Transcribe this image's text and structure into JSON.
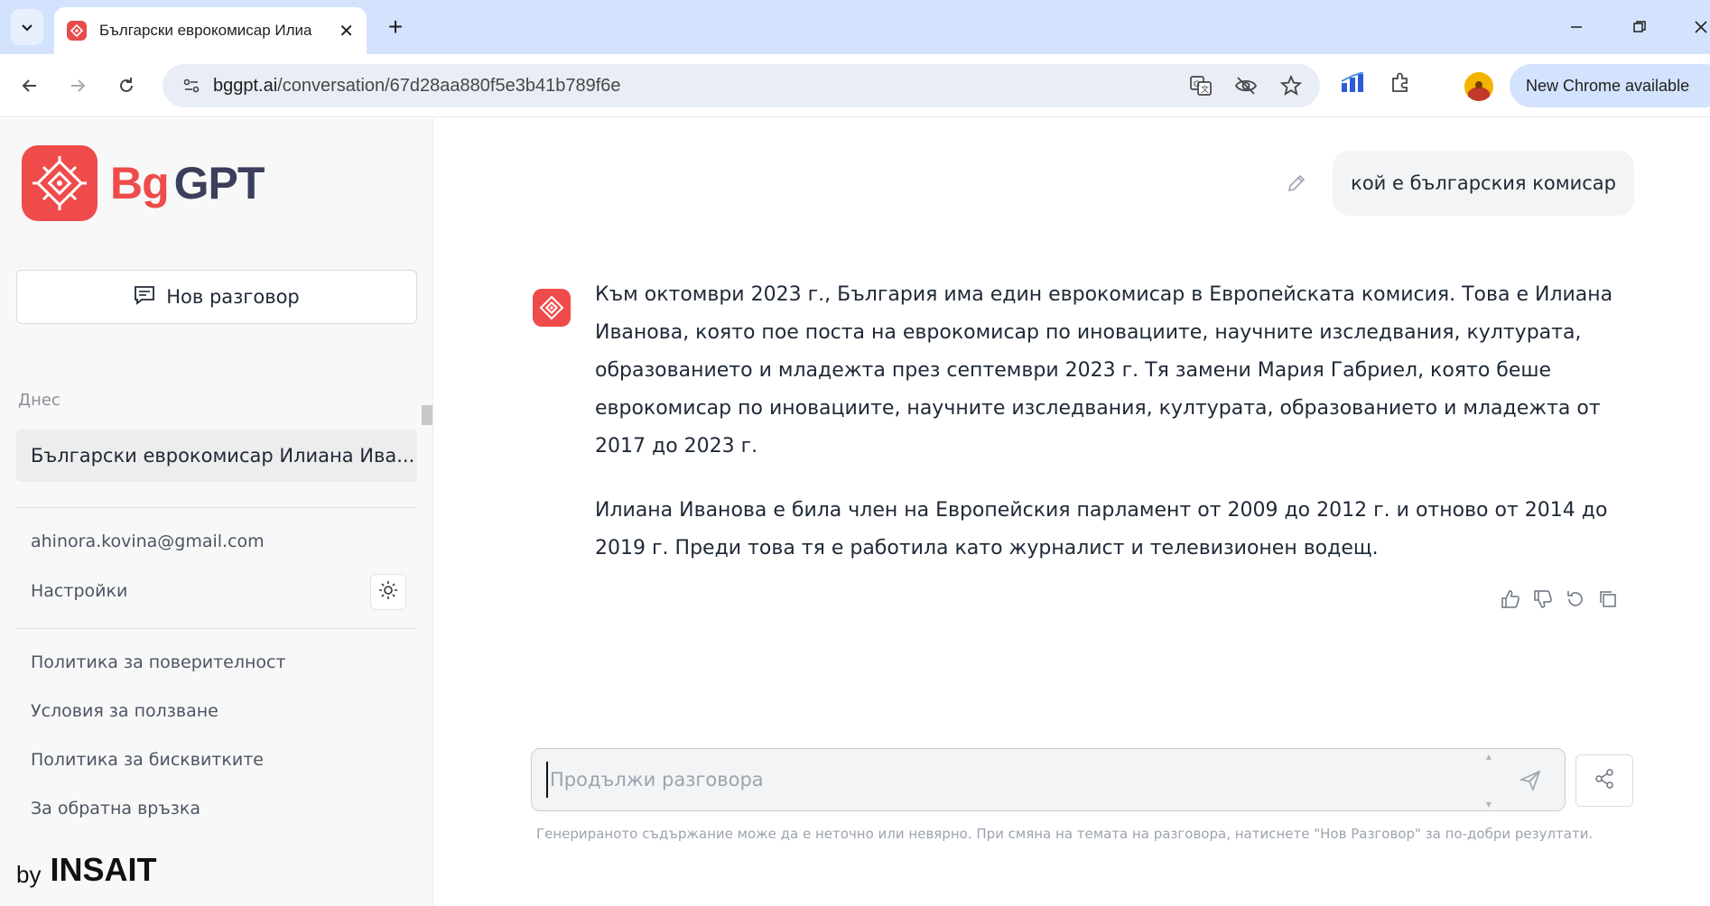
{
  "browser": {
    "tab_title": "Български еврокомисар Илиа",
    "url_host": "bggpt.ai",
    "url_path": "/conversation/67d28aa880f5e3b41b789f6e",
    "update_label": "New Chrome available"
  },
  "sidebar": {
    "logo_bg": "Bg",
    "logo_gpt": "GPT",
    "new_chat_label": "Нов разговор",
    "section_today": "Днес",
    "conversations": [
      {
        "title": "Български еврокомисар Илиана Ива..."
      }
    ],
    "account_email": "ahinora.kovina@gmail.com",
    "settings_label": "Настройки",
    "links": [
      "Политика за поверителност",
      "Условия за ползване",
      "Политика за бисквитките",
      "За обратна връзка"
    ],
    "footer_by": "by",
    "footer_brand": "INSAIT"
  },
  "chat": {
    "user_message": "кой е българския комисар",
    "assistant_paragraphs": [
      "Към октомври 2023 г., България има един еврокомисар в Европейската комисия. Това е Илиана Иванова, която пое поста на еврокомисар по иновациите, научните изследвания, културата, образованието и младежта през септември 2023 г. Тя замени Мария Габриел, която беше еврокомисар по иновациите, научните изследвания, културата, образованието и младежта от 2017 до 2023 г.",
      "Илиана Иванова е била член на Европейския парламент от 2009 до 2012 г. и отново от 2014 до 2019 г. Преди това тя е работила като журналист и телевизионен водещ."
    ],
    "composer_placeholder": "Продължи разговора",
    "disclaimer": "Генерираното съдържание може да е неточно или невярно. При смяна на темата на разговора, натиснете \"Нов Разговор\" за по-добри резултати."
  },
  "colors": {
    "brand_red": "#ef4b4b",
    "brand_navy": "#3b3f5c",
    "tabstrip": "#d3e3fd"
  },
  "icons": [
    "tab-search-icon",
    "close-icon",
    "plus-icon",
    "minimize-icon",
    "restore-icon",
    "back-icon",
    "forward-icon",
    "reload-icon",
    "site-info-icon",
    "translate-icon",
    "eye-off-icon",
    "star-icon",
    "extensions-icon",
    "chat-icon",
    "sun-icon",
    "edit-icon",
    "thumbs-up-icon",
    "thumbs-down-icon",
    "regenerate-icon",
    "copy-icon",
    "send-icon",
    "share-icon"
  ]
}
